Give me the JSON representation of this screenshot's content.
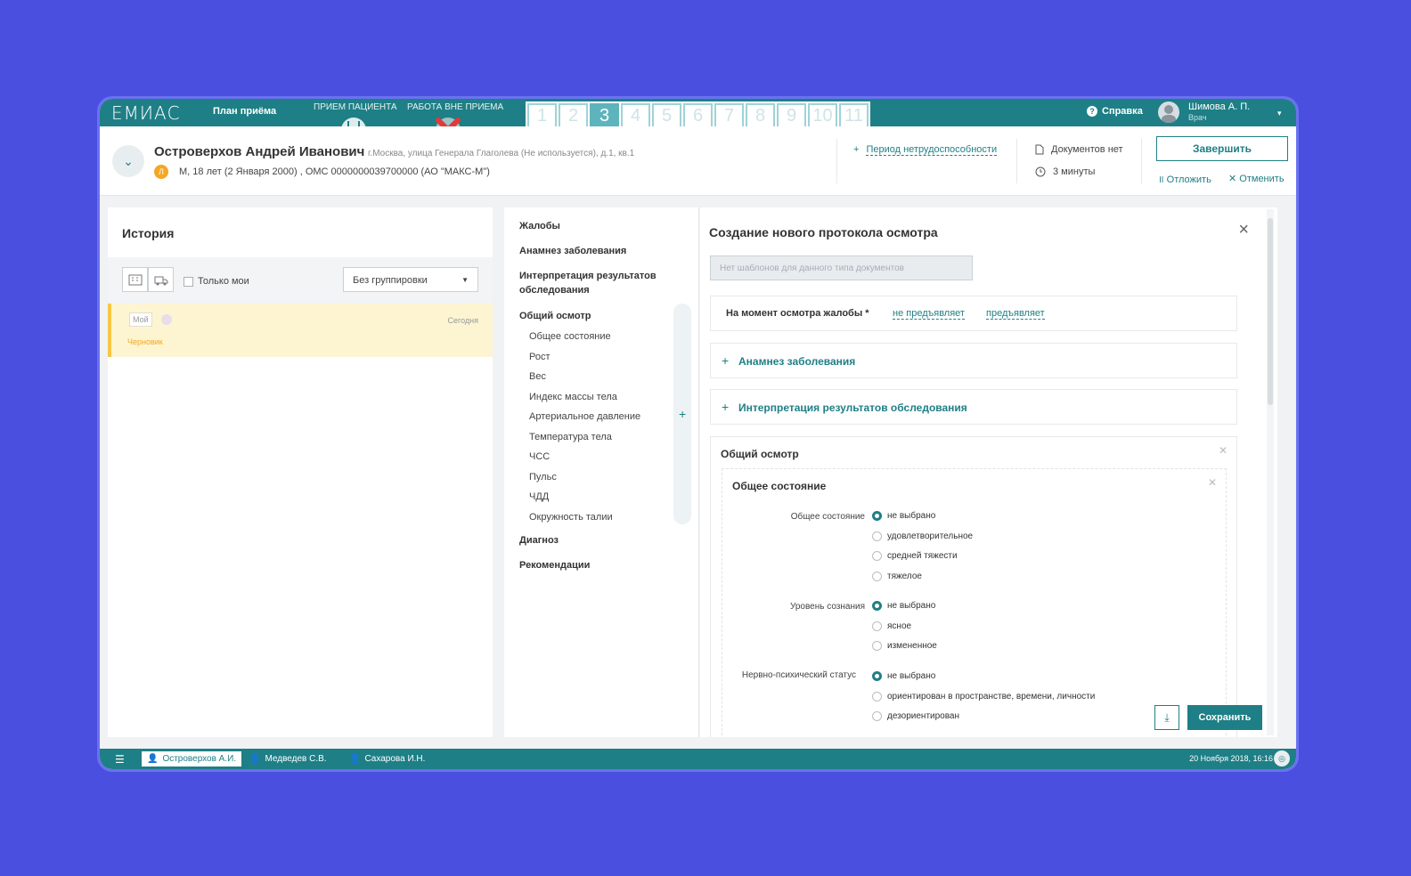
{
  "topbar": {
    "logo": "ЕМИАС",
    "plan": "План приёма",
    "tab_reception": "Прием пациента",
    "tab_outside": "Работа вне приема",
    "film_cells": [
      "1",
      "2",
      "3",
      "4",
      "5",
      "6",
      "7",
      "8",
      "9",
      "10",
      "11"
    ],
    "active_cell": "3",
    "help": "Справка",
    "user_name": "Шимова А. П.",
    "user_role": "Врач"
  },
  "patient": {
    "name": "Островерхов Андрей Иванович",
    "address": "г.Москва, улица Генерала Глаголева (Не используется), д.1, кв.1",
    "badge": "Л",
    "info": "М, 18 лет (2 Января 2000) , ОМС 0000000039700000 (АО \"МАКС-М\")",
    "sick_leave": "Период нетрудоспособности",
    "docs": "Документов нет",
    "timer": "3 минуты",
    "finish": "Завершить",
    "postpone": "Отложить",
    "cancel": "Отменить"
  },
  "history": {
    "title": "История",
    "only_mine": "Только мои",
    "grouping": "Без группировки",
    "draft": {
      "tag": "Мой",
      "date": "Сегодня",
      "state": "Черновик"
    }
  },
  "toc": {
    "items": [
      {
        "label": "Жалобы"
      },
      {
        "label": "Анамнез заболевания"
      },
      {
        "label": "Интерпретация результатов обследования"
      },
      {
        "label": "Общий осмотр"
      },
      {
        "label": "Диагноз"
      },
      {
        "label": "Рекомендации"
      }
    ],
    "subitems": [
      "Общее состояние",
      "Рост",
      "Вес",
      "Индекс массы тела",
      "Артериальное давление",
      "Температура тела",
      "ЧСС",
      "Пульс",
      "ЧДД",
      "Окружность талии"
    ]
  },
  "form": {
    "title": "Создание нового протокола осмотра",
    "template_placeholder": "Нет шаблонов для данного типа документов",
    "complaints_label": "На момент осмотра жалобы *",
    "complaints_opt1": "не предъявляет",
    "complaints_opt2": "предъявляет",
    "anamnesis": "Анамнез заболевания",
    "interpretation": "Интерпретация результатов обследования",
    "general": "Общий осмотр",
    "state_title": "Общее состояние",
    "questions": [
      {
        "label": "Общее состояние",
        "options": [
          "не выбрано",
          "удовлетворительное",
          "средней тяжести",
          "тяжелое"
        ]
      },
      {
        "label": "Уровень сознания",
        "options": [
          "не выбрано",
          "ясное",
          "измененное"
        ]
      },
      {
        "label": "Нервно-психический статус",
        "options": [
          "не выбрано",
          "ориентирован в пространстве, времени, личности",
          "дезориентирован"
        ]
      }
    ],
    "save": "Сохранить"
  },
  "bottombar": {
    "tabs": [
      "Островерхов А.И.",
      "Медведев С.В.",
      "Сахарова И.Н."
    ],
    "date": "20 Ноября 2018, 16:16"
  },
  "colors": {
    "accent": "#1e7f86",
    "background": "#4b4fe0",
    "draft": "#fdf5d2"
  }
}
